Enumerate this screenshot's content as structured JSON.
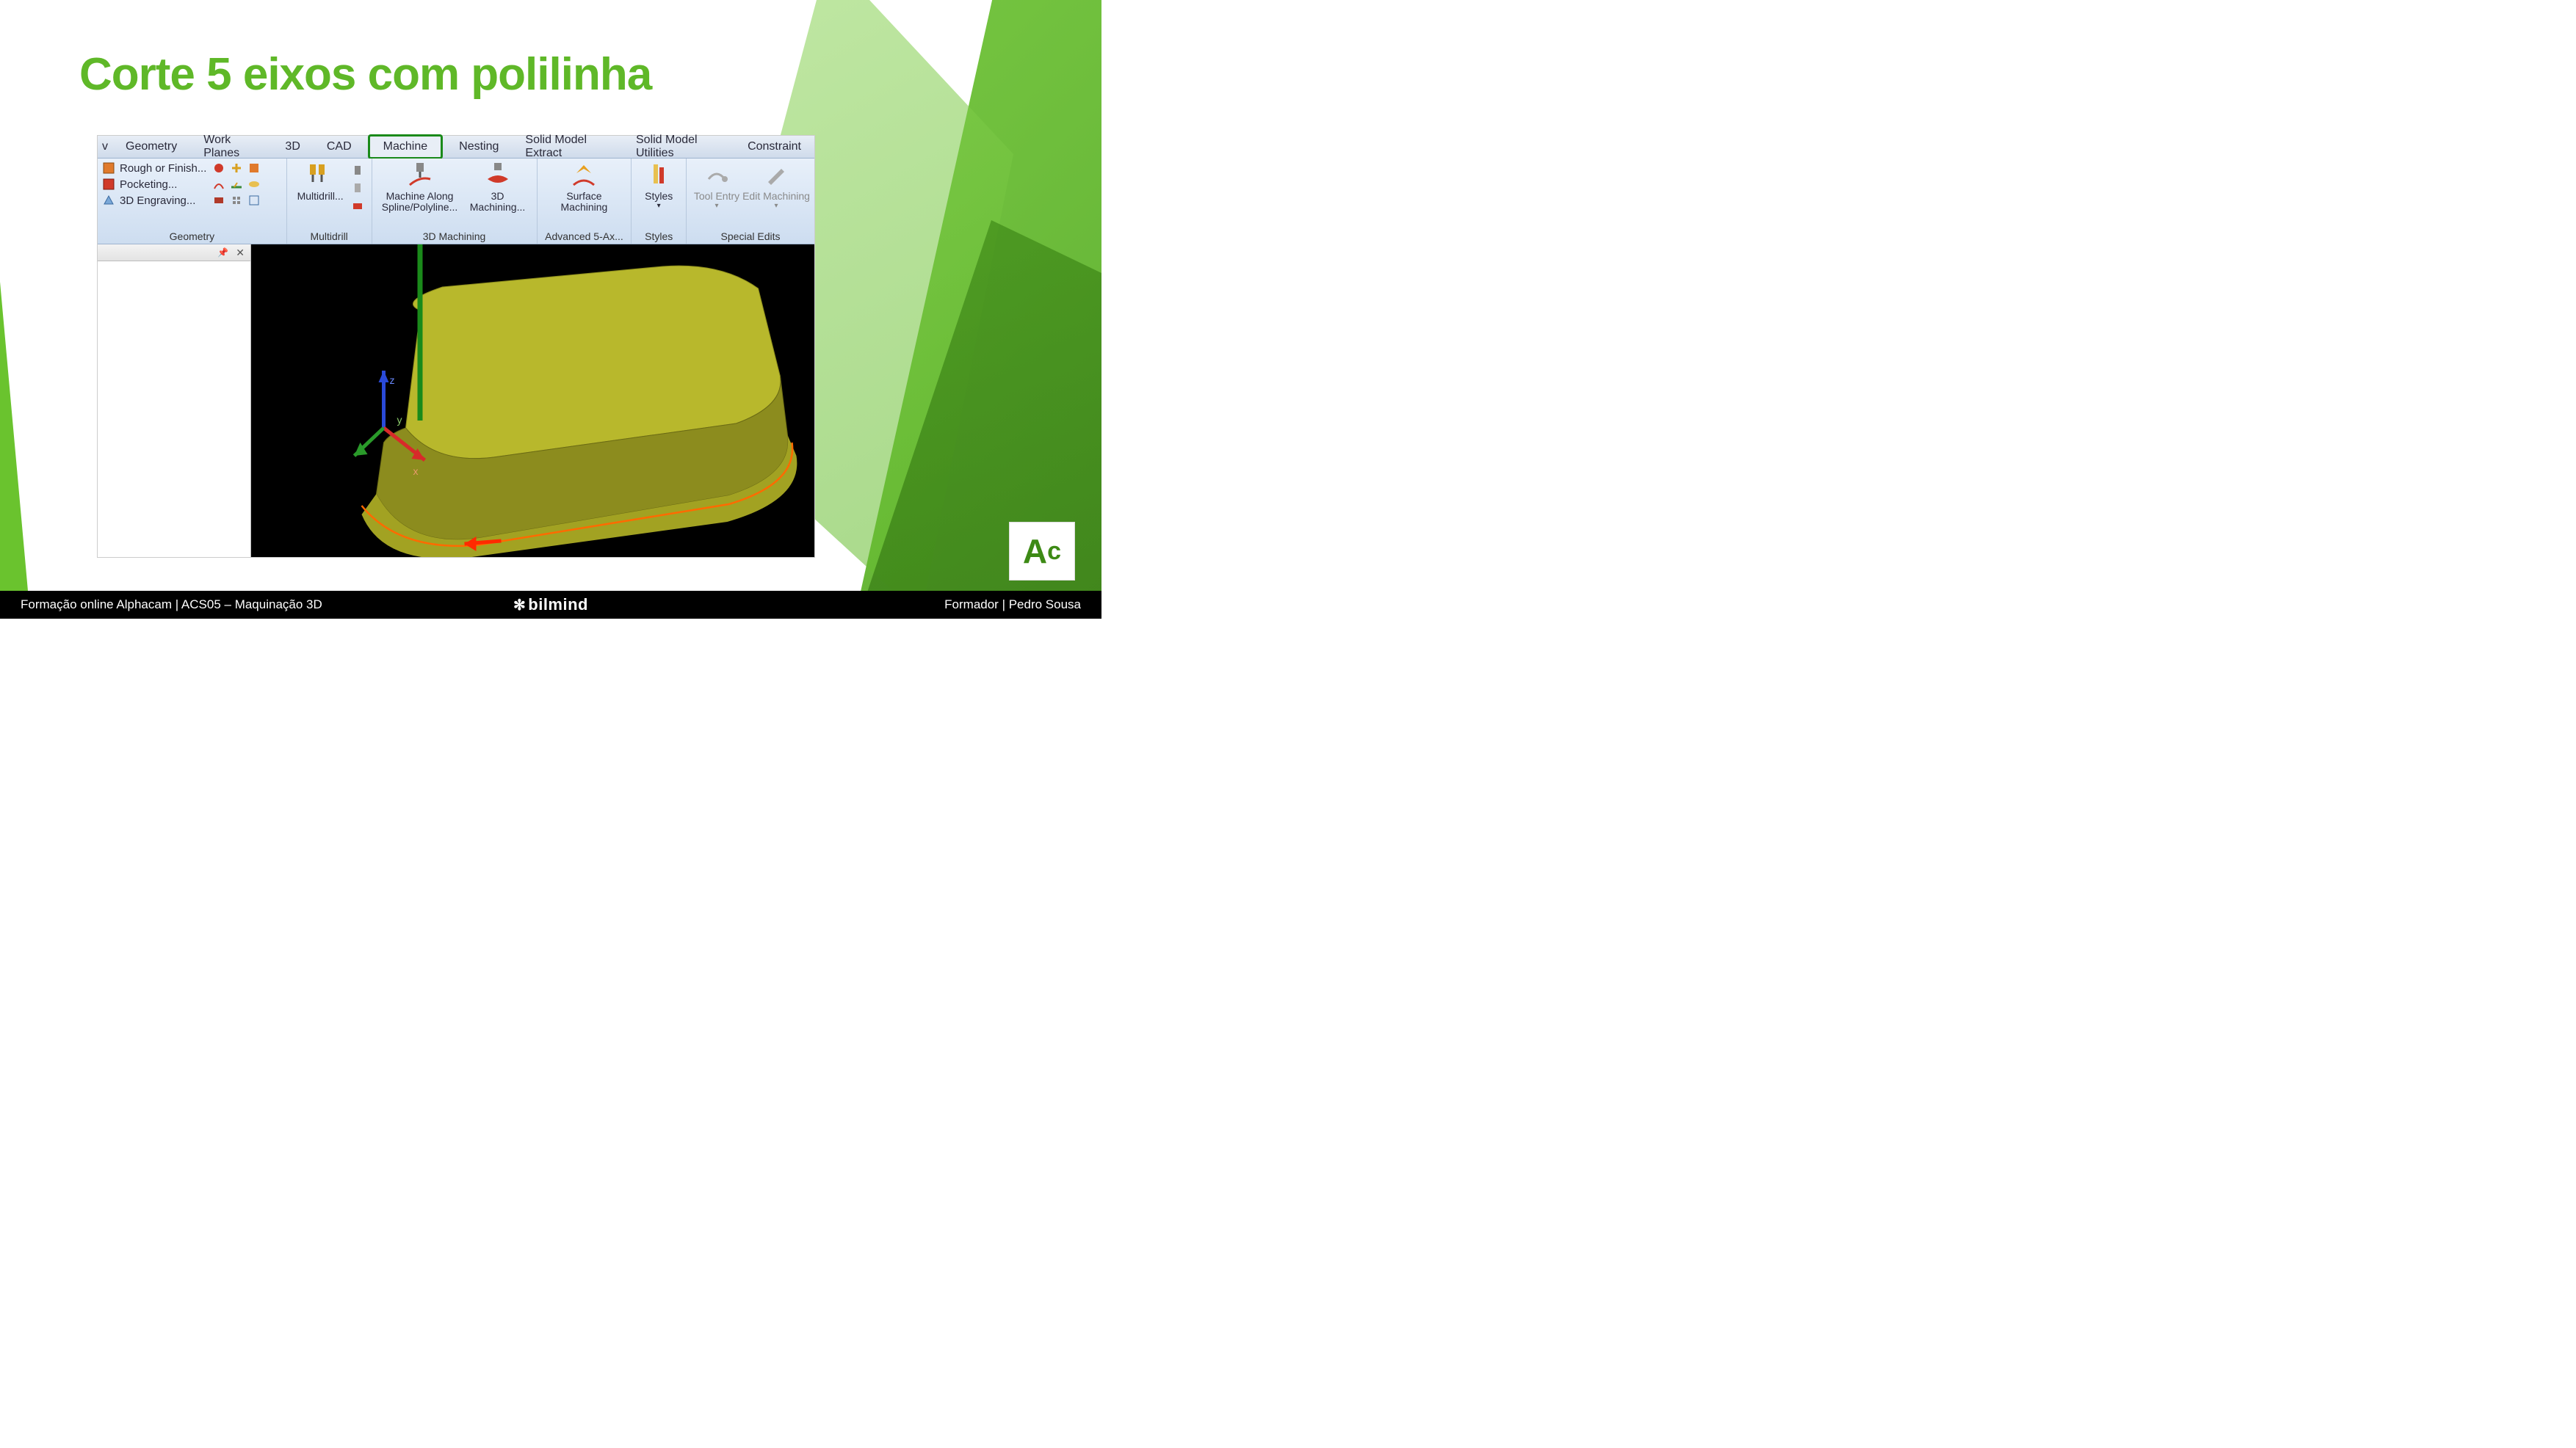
{
  "title": "Corte 5 eixos com polilinha",
  "footer": {
    "left": "Formação online Alphacam | ACS05 – Maquinação 3D",
    "center_brand": "bilmind",
    "right": "Formador | Pedro Sousa"
  },
  "logo": {
    "a": "A",
    "c": "c"
  },
  "tabs": {
    "view_cut": "v",
    "geometry": "Geometry",
    "work_planes": "Work Planes",
    "three_d": "3D",
    "cad_cut": "CAD",
    "machine": "Machine",
    "nesting": "Nesting",
    "solid_extract": "Solid Model Extract",
    "solid_utilities": "Solid Model Utilities",
    "constraint_cut": "Constraint"
  },
  "ribbon": {
    "geometry_group": {
      "label": "Geometry",
      "items": {
        "rough": "Rough or Finish...",
        "pocket": "Pocketing...",
        "engrave": "3D Engraving..."
      }
    },
    "multidrill_group": {
      "label": "Multidrill",
      "button": "Multidrill..."
    },
    "machining3d_group": {
      "label": "3D Machining",
      "spline": "Machine Along Spline/Polyline...",
      "mach3d": "3D Machining..."
    },
    "adv5ax_group": {
      "label": "Advanced 5-Ax...",
      "surface": "Surface Machining"
    },
    "styles_group": {
      "label": "Styles",
      "button": "Styles"
    },
    "special_group": {
      "label": "Special Edits",
      "tool_entry": "Tool Entry",
      "edit_mach": "Edit Machining"
    }
  },
  "panel": {
    "pin": "📌",
    "close": "✕"
  }
}
